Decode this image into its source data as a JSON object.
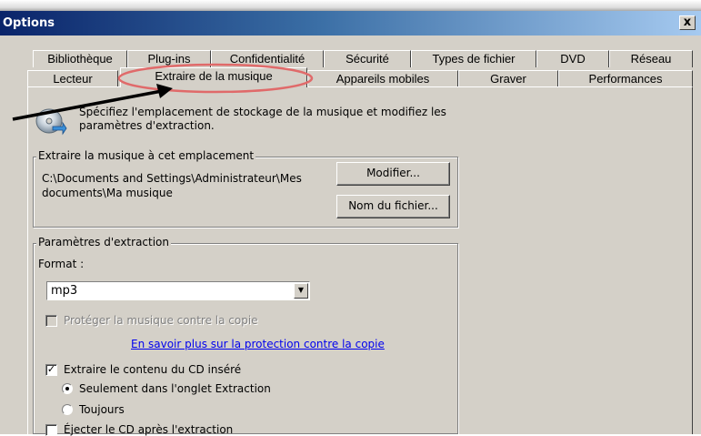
{
  "window": {
    "title": "Options",
    "close_label": "x"
  },
  "tabs_row1": [
    {
      "label": "Bibliothèque"
    },
    {
      "label": "Plug-ins"
    },
    {
      "label": "Confidentialité"
    },
    {
      "label": "Sécurité"
    },
    {
      "label": "Types de fichier"
    },
    {
      "label": "DVD"
    },
    {
      "label": "Réseau"
    }
  ],
  "tabs_row2": [
    {
      "label": "Lecteur"
    },
    {
      "label": "Extraire de la musique",
      "active": true
    },
    {
      "label": "Appareils mobiles"
    },
    {
      "label": "Graver"
    },
    {
      "label": "Performances"
    }
  ],
  "header": {
    "description": "Spécifiez l'emplacement de stockage de la musique et modifiez les paramètres d'extraction.",
    "icon": "cd-rip-icon"
  },
  "location_group": {
    "legend": "Extraire la musique à cet emplacement",
    "path": "C:\\Documents and Settings\\Administrateur\\Mes documents\\Ma musique",
    "modify_button": "Modifier...",
    "filename_button": "Nom du fichier..."
  },
  "settings_group": {
    "legend": "Paramètres d'extraction",
    "format_label": "Format :",
    "format_value": "mp3",
    "protect_label": "Protéger la musique contre la copie",
    "protect_checked": false,
    "protect_enabled": false,
    "learn_more_link": "En savoir plus sur la protection contre la copie",
    "rip_cd_label": "Extraire le contenu du CD inséré",
    "rip_cd_checked": true,
    "radio_only_tab": "Seulement dans l'onglet Extraction",
    "radio_always": "Toujours",
    "radio_selected": "only_tab",
    "eject_label": "Éjecter le CD après l'extraction",
    "eject_checked": false
  },
  "annotation": {
    "highlight_color": "#e06a6a",
    "arrow_color": "#000000"
  }
}
